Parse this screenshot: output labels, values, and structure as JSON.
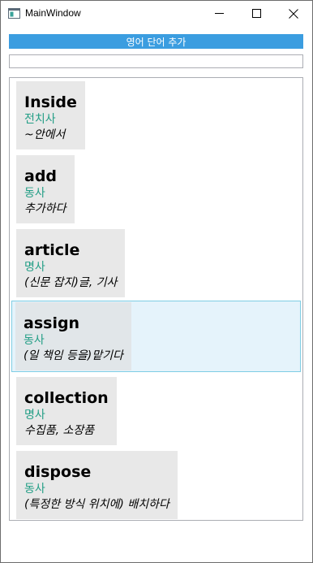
{
  "window": {
    "title": "MainWindow"
  },
  "toolbar": {
    "add_label": "영어 단어 추가"
  },
  "search": {
    "value": "",
    "placeholder": ""
  },
  "words": [
    {
      "word": "Inside",
      "pos": "전치사",
      "meaning": "~안에서"
    },
    {
      "word": "add",
      "pos": "동사",
      "meaning": "추가하다"
    },
    {
      "word": "article",
      "pos": "명사",
      "meaning": "(신문 잡지)글, 기사"
    },
    {
      "word": "assign",
      "pos": "동사",
      "meaning": "(일 책임 등을)맡기다"
    },
    {
      "word": "collection",
      "pos": "명사",
      "meaning": "수집품, 소장품"
    },
    {
      "word": "dispose",
      "pos": "동사",
      "meaning": "(특정한 방식 위치에) 배치하다"
    }
  ],
  "selected_index": 3,
  "colors": {
    "accent": "#3b9de0",
    "part_of_speech": "#239e86",
    "card_bg": "#e8e8e8",
    "selection_bg": "#e5f3fb",
    "selection_border": "#7fcde4"
  },
  "icons": {
    "app": "window-app-icon",
    "minimize": "minimize-icon",
    "maximize": "maximize-icon",
    "close": "close-icon"
  }
}
